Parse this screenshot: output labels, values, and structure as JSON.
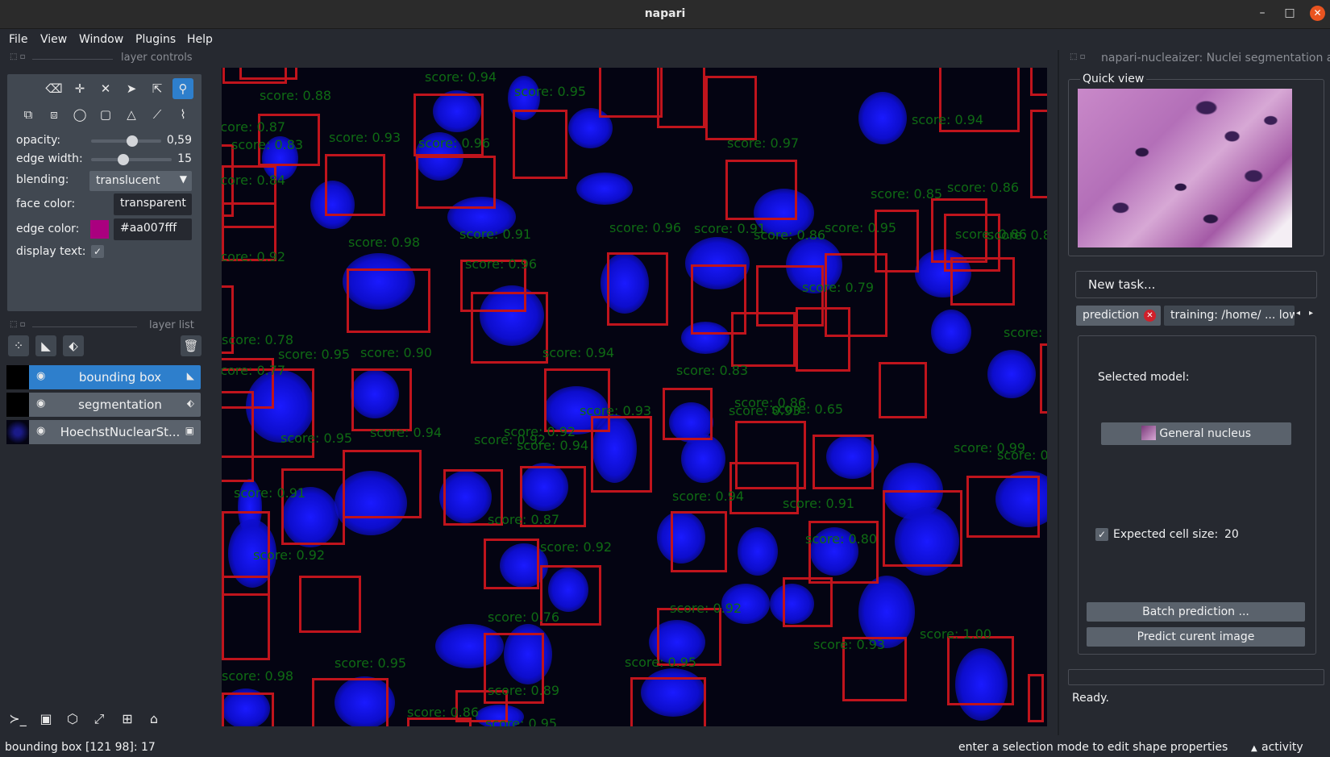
{
  "window": {
    "title": "napari"
  },
  "menu": [
    "File",
    "View",
    "Window",
    "Plugins",
    "Help"
  ],
  "layer_controls": {
    "header": "layer controls",
    "opacity_label": "opacity:",
    "opacity_value": "0,59",
    "opacity_level": 0.59,
    "edge_width_label": "edge width:",
    "edge_width_value": "15",
    "blending_label": "blending:",
    "blending_value": "translucent",
    "face_color_label": "face color:",
    "face_color_value": "transparent",
    "edge_color_label": "edge color:",
    "edge_color_value": "#aa007fff",
    "edge_color_swatch": "#aa007f",
    "display_text_label": "display text:",
    "display_text_checked": true
  },
  "layer_list": {
    "header": "layer list",
    "layers": [
      {
        "name": "bounding box",
        "type_icon": "shapes-icon",
        "selected": true
      },
      {
        "name": "segmentation",
        "type_icon": "labels-icon",
        "selected": false
      },
      {
        "name": "HoechstNuclearSt...",
        "type_icon": "image-icon",
        "selected": false
      }
    ]
  },
  "plugin": {
    "header": "napari-nucleaizer: Nuclei segmentation a",
    "quick_view_label": "Quick view",
    "new_task_label": "New task...",
    "tabs": [
      "prediction",
      "training: /home/ ... low"
    ],
    "selected_model_label": "Selected model:",
    "model_button_label": "General nucleus",
    "expected_cell_size_label": "Expected cell size:",
    "expected_cell_size_value": "20",
    "expected_cell_size_checked": true,
    "batch_prediction_label": "Batch prediction ...",
    "predict_current_label": "Predict curent image",
    "status": "Ready."
  },
  "canvas": {
    "scores": [
      "score: 0.94",
      "score: 0.95",
      "score: 0.88",
      "score: 0.83",
      "score: 0.93",
      "score: 0.96",
      "score: 0.97",
      "score: 0.94",
      "score: 0.84",
      "score: 0.87",
      "score: 0.92",
      "score: 0.98",
      "score: 0.91",
      "score: 0.96",
      "score: 0.96",
      "score: 0.91",
      "score: 0.86",
      "score: 0.95",
      "score: 0.86",
      "score: 0.79",
      "score: 0.88",
      "score: 0.85",
      "score: 0.86",
      "score: 0.78",
      "score: 0.95",
      "score: 0.77",
      "score: 0.90",
      "score: 0.94",
      "score: 0.83",
      "score: 0.86",
      "score: 0.93",
      "score: 0.93",
      "score: 0.65",
      "score: 0.92",
      "score: 0.95",
      "score: 0.94",
      "score: 0.92",
      "score: 0.94",
      "score: 0.99",
      "score: 0.99",
      "score: 0.91",
      "score: 0.87",
      "score: 0.94",
      "score: 0.92",
      "score: 0.92",
      "score: 0.91",
      "score: 0.80",
      "score: 0.76",
      "score: 0.92",
      "score: 1.00",
      "score: 0.93",
      "score: 0.95",
      "score: 0.98",
      "score: 0.95",
      "score: 0.89",
      "score: 0.86",
      "score: 0.95",
      "score: 0.9"
    ]
  },
  "statusbar": {
    "left": "bounding box [121  98]: 17",
    "right": "enter a selection mode to edit shape properties",
    "activity": "activity"
  }
}
